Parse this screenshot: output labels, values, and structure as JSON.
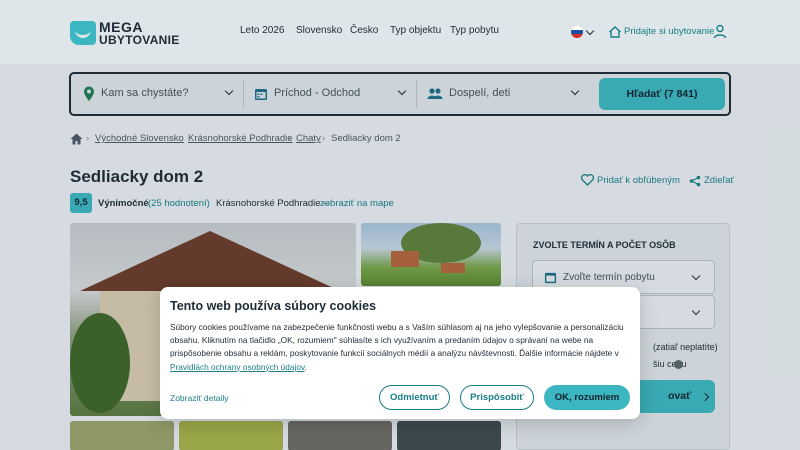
{
  "header": {
    "logo_line1": "MEGA",
    "logo_line2": "UBYTOVANIE",
    "nav": [
      "Leto 2026",
      "Slovensko",
      "Česko",
      "Typ objektu",
      "Typ pobytu"
    ],
    "sell_link": "Pridajte si ubytovanie",
    "language_flag": "slovak-flag"
  },
  "search": {
    "destination_placeholder": "Kam sa chystáte?",
    "dates_placeholder": "Príchod - Odchod",
    "guests_placeholder": "Dospelí, deti",
    "button_label": "Hľadať (7 841)"
  },
  "breadcrumb": [
    "Východné Slovensko",
    "Krásnohorské Podhradie",
    "Chaty",
    "Sedliacky dom 2"
  ],
  "listing": {
    "title": "Sedliacky dom 2",
    "favorite_label": "Pridať k obľúbeným",
    "share_label": "Zdieľať",
    "score": "9,5",
    "rating_text": "Výnimočné",
    "reviews": "(25 hodnotení)",
    "location": "Krásnohorské Podhradie –",
    "map_link": "zobraziť na mape"
  },
  "booking": {
    "title": "ZVOLTE TERMÍN A POČET OSÔB",
    "date_placeholder": "Zvoľte termín pobytu",
    "note1": "(zatiaľ neplatíte)",
    "note2": "šiu cenu",
    "button_label": "ovať"
  },
  "cookie": {
    "title": "Tento web používa súbory cookies",
    "text": "Súbory cookies používame na zabezpečenie funkčnosti webu a s Vaším súhlasom aj na jeho vylepšovanie a personalizáciu obsahu. Kliknutím na tlačidlo „OK, rozumiem\" súhlasíte s ich využívaním a predaním údajov o správaní na webe na prispôsobenie obsahu a reklám, poskytovanie funkcií sociálnych médií a analýzu návštevnosti. Ďalšie informácie nájdete v",
    "privacy_link": "Pravidlách ochrany osobných údajov",
    "text_end": ".",
    "details_link": "Zobraziť detaily",
    "reject": "Odmietnuť",
    "customize": "Prispôsobiť",
    "accept": "OK, rozumiem"
  },
  "colors": {
    "accent": "#3cb6c0",
    "link": "#197e86",
    "text": "#1d2b36"
  }
}
